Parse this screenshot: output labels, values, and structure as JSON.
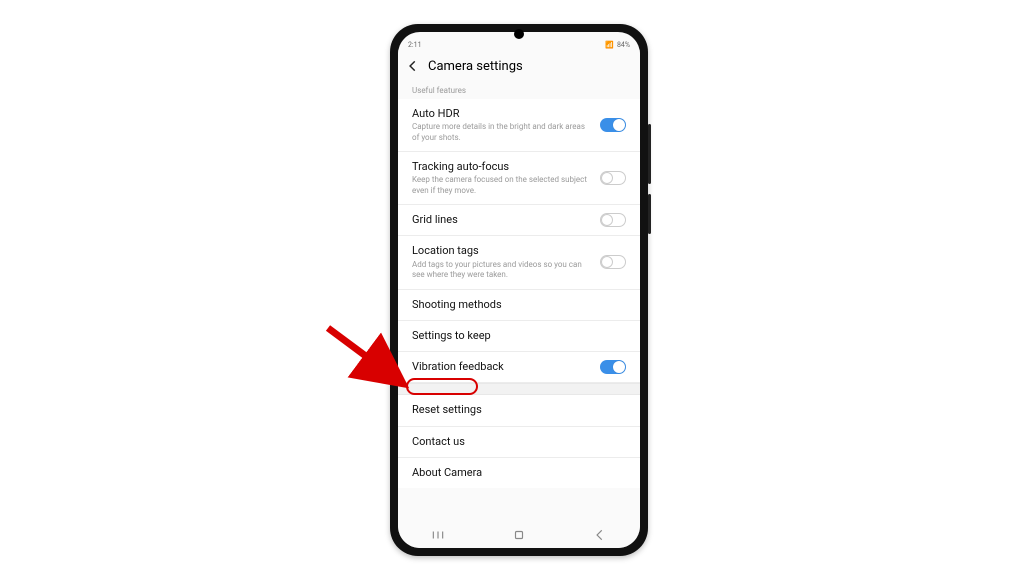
{
  "status": {
    "left": "2:11",
    "right": "84%"
  },
  "header": {
    "title": "Camera settings"
  },
  "section": {
    "useful_features": "Useful features"
  },
  "rows": {
    "auto_hdr": {
      "title": "Auto HDR",
      "sub": "Capture more details in the bright and dark areas of your shots."
    },
    "tracking_af": {
      "title": "Tracking auto-focus",
      "sub": "Keep the camera focused on the selected subject even if they move."
    },
    "grid_lines": {
      "title": "Grid lines"
    },
    "location_tags": {
      "title": "Location tags",
      "sub": "Add tags to your pictures and videos so you can see where they were taken."
    },
    "shooting_methods": {
      "title": "Shooting methods"
    },
    "settings_keep": {
      "title": "Settings to keep"
    },
    "vibration": {
      "title": "Vibration feedback"
    },
    "reset": {
      "title": "Reset settings"
    },
    "contact": {
      "title": "Contact us"
    },
    "about": {
      "title": "About Camera"
    }
  },
  "annotation": {
    "highlight_target": "reset-settings-row"
  }
}
